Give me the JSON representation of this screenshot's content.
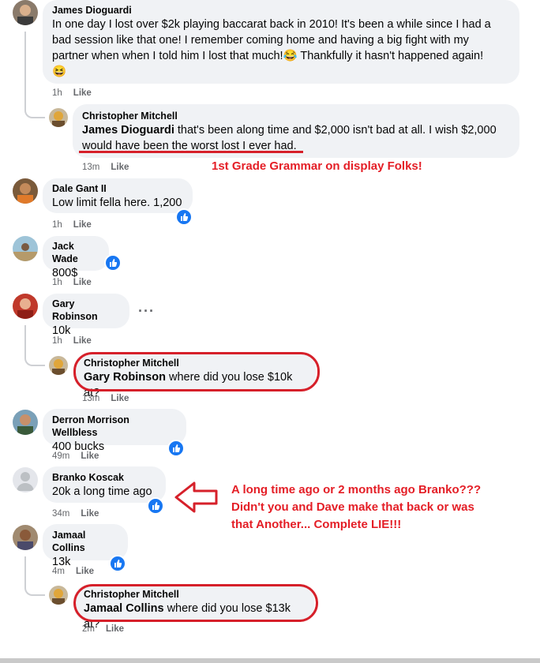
{
  "comments": [
    {
      "name": "James Dioguardi",
      "lines": [
        "In one day I lost over $2k playing baccarat back in 2010! It's been a while since I had a",
        "bad session like that one! I remember coming home and having a big fight with my",
        "partner when when I told him I lost that much!😂 Thankfully it hasn't happened again!",
        "😆"
      ],
      "time": "1h",
      "like": "Like"
    },
    {
      "name": "Christopher Mitchell",
      "mention": "James Dioguardi",
      "line1": " that's been along time and $2,000 isn't bad at all. I wish $2,000",
      "line2": "would have been the worst lost I ever had.",
      "time": "13m",
      "like": "Like"
    },
    {
      "name": "Dale Gant II",
      "text": "Low limit fella here. 1,200",
      "time": "1h",
      "like": "Like"
    },
    {
      "name": "Jack Wade",
      "text": "800$",
      "time": "1h",
      "like": "Like"
    },
    {
      "name": "Gary Robinson",
      "text": "10k",
      "time": "1h",
      "like": "Like",
      "more": "···"
    },
    {
      "name": "Christopher Mitchell",
      "mention": "Gary Robinson",
      "text": " where did you lose $10k at?",
      "time": "13m",
      "like": "Like"
    },
    {
      "name": "Derron Morrison Wellbless",
      "text": "400 bucks",
      "time": "49m",
      "like": "Like"
    },
    {
      "name": "Branko Koscak",
      "text": "20k a long time ago",
      "time": "34m",
      "like": "Like"
    },
    {
      "name": "Jamaal Collins",
      "text": "13k",
      "time": "4m",
      "like": "Like"
    },
    {
      "name": "Christopher Mitchell",
      "mention": "Jamaal Collins",
      "text": " where did you lose $13k at?",
      "time": "2m",
      "like": "Like"
    }
  ],
  "annotations": {
    "grammar": "1st Grade Grammar on display Folks!",
    "branko": [
      "A long time ago or 2 months ago Branko???",
      "Didn't you and Dave make that back or was",
      "that Another... Complete LIE!!!"
    ]
  },
  "colors": {
    "bubble": "#f0f2f5",
    "annotation": "#e41e26",
    "reaction": "#1877f2",
    "meta": "#65676b"
  }
}
